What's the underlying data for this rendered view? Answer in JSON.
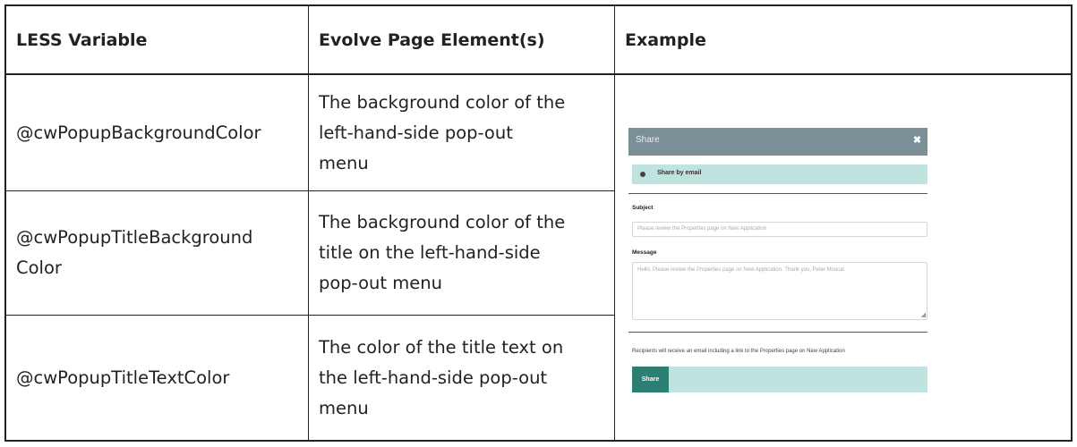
{
  "headers": {
    "col1": "LESS Variable",
    "col2": "Evolve Page Element(s)",
    "col3": "Example"
  },
  "rows": [
    {
      "variable_lines": [
        "@cwPopupBackgroundColor"
      ],
      "element_lines": [
        "The background color of the",
        "left-hand-side pop-out",
        "menu"
      ]
    },
    {
      "variable_lines": [
        "@cwPopupTitleBackground",
        "Color"
      ],
      "element_lines": [
        "The background color of the",
        "title on the left-hand-side",
        "pop-out menu"
      ]
    },
    {
      "variable_lines": [
        "@cwPopupTitleTextColor"
      ],
      "element_lines": [
        "The color of the title text on",
        "the left-hand-side pop-out",
        "menu"
      ]
    }
  ],
  "example": {
    "title": "Share",
    "close_icon": "close-icon",
    "share_option": "Share by email",
    "subject_label": "Subject",
    "subject_value": "Please review the Properties page on New Application",
    "message_label": "Message",
    "message_value": "Hello, Please review the Properties page on New Application. Thank you, Peter Muscat",
    "note": "Recipients will receive an email including a link to the Properties page on New Application",
    "share_button": "Share",
    "colors": {
      "title_bar": "#7a8f96",
      "accent_light": "#bfe3de",
      "button": "#2d7f73"
    }
  }
}
